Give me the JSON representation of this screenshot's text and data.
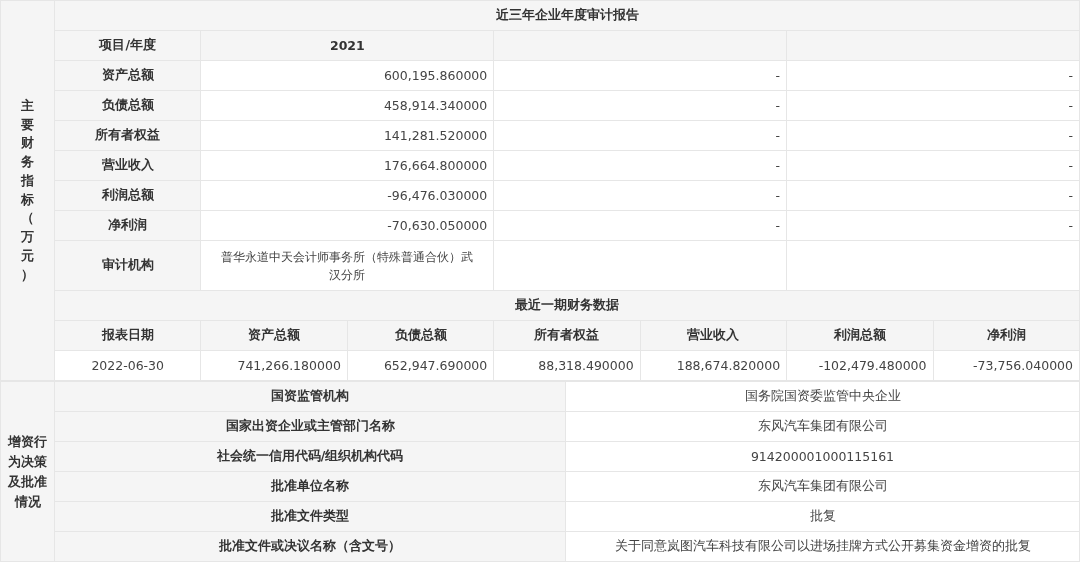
{
  "financial_section": {
    "side_label": "主要财务指标（万元）",
    "title": "近三年企业年度审计报告",
    "header": {
      "label": "项目/年度",
      "years": [
        "2021"
      ]
    },
    "rows": [
      {
        "kind": "number",
        "label": "资产总额",
        "values": [
          "600,195.860000",
          "-",
          "-"
        ]
      },
      {
        "kind": "number",
        "label": "负债总额",
        "values": [
          "458,914.340000",
          "-",
          "-"
        ]
      },
      {
        "kind": "number",
        "label": "所有者权益",
        "values": [
          "141,281.520000",
          "-",
          "-"
        ]
      },
      {
        "kind": "number",
        "label": "营业收入",
        "values": [
          "176,664.800000",
          "-",
          "-"
        ]
      },
      {
        "kind": "number",
        "label": "利润总额",
        "values": [
          "-96,476.030000",
          "-",
          "-"
        ]
      },
      {
        "kind": "number",
        "label": "净利润",
        "values": [
          "-70,630.050000",
          "-",
          "-"
        ]
      },
      {
        "kind": "text",
        "label": "审计机构",
        "values": [
          "普华永道中天会计师事务所（特殊普通合伙）武汉分所"
        ]
      }
    ],
    "recent": {
      "title": "最近一期财务数据",
      "columns": [
        "报表日期",
        "资产总额",
        "负债总额",
        "所有者权益",
        "营业收入",
        "利润总额",
        "净利润"
      ],
      "row": [
        "2022-06-30",
        "741,266.180000",
        "652,947.690000",
        "88,318.490000",
        "188,674.820000",
        "-102,479.480000",
        "-73,756.040000"
      ]
    }
  },
  "approval_section": {
    "side_label": "增资行为决策及批准情况",
    "rows": [
      {
        "label": "国资监管机构",
        "value": "国务院国资委监管中央企业"
      },
      {
        "label": "国家出资企业或主管部门名称",
        "value": "东风汽车集团有限公司"
      },
      {
        "label": "社会统一信用代码/组织机构代码",
        "value": "914200001000115161"
      },
      {
        "label": "批准单位名称",
        "value": "东风汽车集团有限公司"
      },
      {
        "label": "批准文件类型",
        "value": "批复"
      },
      {
        "label": "批准文件或决议名称（含文号）",
        "value": "关于同意岚图汽车科技有限公司以进场挂牌方式公开募集资金增资的批复"
      }
    ]
  }
}
